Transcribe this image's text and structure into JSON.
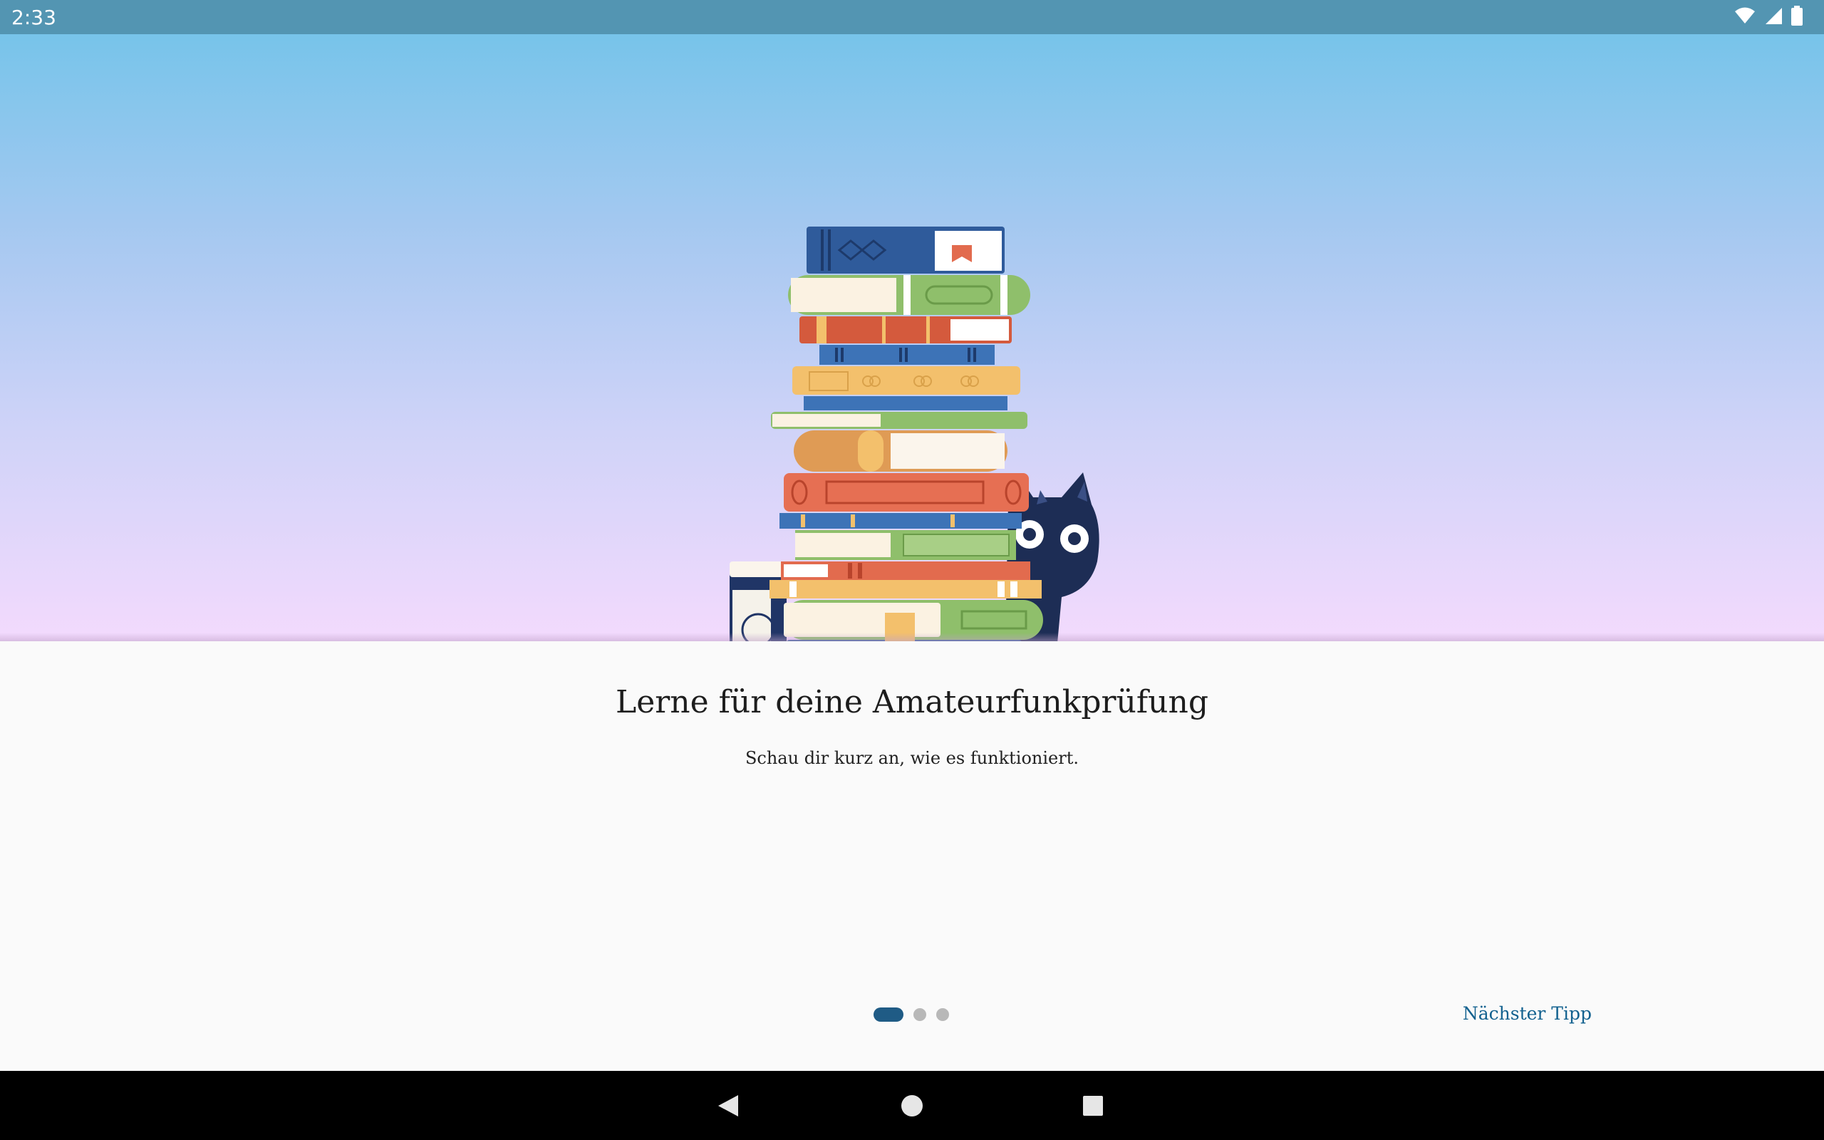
{
  "status_bar": {
    "time": "2:33",
    "icons": [
      "wifi-icon",
      "cell-signal-icon",
      "battery-icon"
    ]
  },
  "hero": {
    "illustration": "stack-of-books-with-cat-icon",
    "colors": {
      "gradient_top": "#77c4ea",
      "gradient_bottom": "#f3dafd"
    }
  },
  "onboarding": {
    "title": "Lerne für deine Amateurfunkprüfung",
    "subtitle": "Schau dir kurz an, wie es funktioniert.",
    "page_indicator": {
      "total": 3,
      "current": 1
    },
    "next_button_label": "Nächster Tipp"
  },
  "navigation_bar": {
    "buttons": [
      "back-icon",
      "home-icon",
      "recents-icon"
    ]
  },
  "colors": {
    "accent": "#12618f",
    "active_dot": "#1f5b85",
    "inactive_dot": "#b8b8b8",
    "status_bar": "#5395b2"
  }
}
